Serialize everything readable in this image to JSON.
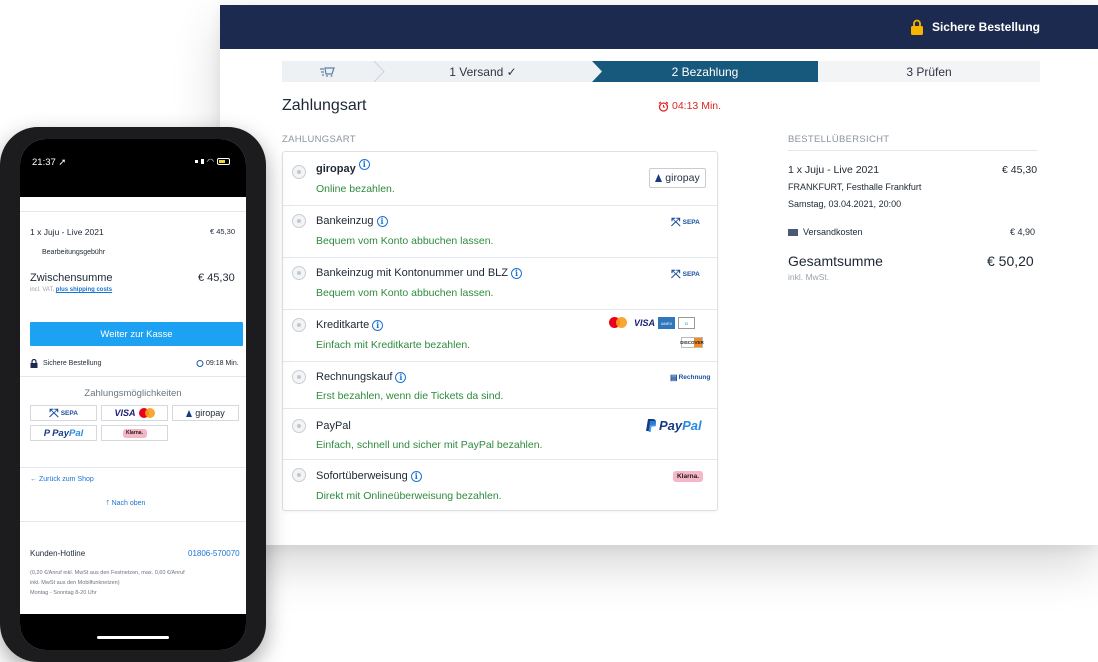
{
  "header": {
    "secure_label": "Sichere Bestellung"
  },
  "steps": [
    {
      "label": ""
    },
    {
      "label": "1 Versand ✓"
    },
    {
      "label": "2 Bezahlung"
    },
    {
      "label": "3 Prüfen"
    }
  ],
  "page_title": "Zahlungsart",
  "timer": "04:13 Min.",
  "section_label": "ZAHLUNGSART",
  "payment_methods": [
    {
      "name": "giropay",
      "desc": "Online bezahlen.",
      "logo": "giropay"
    },
    {
      "name": "Bankeinzug",
      "desc": "Bequem vom Konto abbuchen lassen.",
      "logo": "SEPA"
    },
    {
      "name": "Bankeinzug mit Kontonummer und BLZ",
      "desc": "Bequem vom Konto abbuchen lassen.",
      "logo": "SEPA"
    },
    {
      "name": "Kreditkarte",
      "desc": "Einfach mit Kreditkarte bezahlen.",
      "logo": "cards"
    },
    {
      "name": "Rechnungskauf",
      "desc": "Erst bezahlen, wenn die Tickets da sind.",
      "logo": "Rechnung"
    },
    {
      "name": "PayPal",
      "desc": "Einfach, schnell und sicher mit PayPal bezahlen.",
      "logo": "PayPal"
    },
    {
      "name": "Sofortüberweisung",
      "desc": "Direkt mit Onlineüberweisung bezahlen.",
      "logo": "Klarna."
    }
  ],
  "logos": {
    "giropay": "giropay",
    "sepa": "SEPA",
    "rechnung": "Rechnung",
    "paypal_1": "Pay",
    "paypal_2": "Pal",
    "klarna": "Klarna.",
    "visa": "VISA",
    "discover": "DISCOVER"
  },
  "overview": {
    "label": "BESTELLÜBERSICHT",
    "item": "1 x Juju - Live 2021",
    "item_price": "€ 45,30",
    "venue": "FRANKFURT, Festhalle Frankfurt",
    "date": "Samstag, 03.04.2021, 20:00",
    "shipping_label": "Versandkosten",
    "shipping_price": "€ 4,90",
    "total_label": "Gesamtsumme",
    "total_price": "€ 50,20",
    "tax_note": "inkl. MwSt."
  },
  "phone": {
    "time": "21:37",
    "item": "1 x Juju - Live 2021",
    "item_price": "€ 45,30",
    "fee": "Bearbeitungsgebühr",
    "subtotal_label": "Zwischensumme",
    "subtotal_price": "€ 45,30",
    "vat_note": "incl. VAT,",
    "shipping_link": "plus shipping costs",
    "cta": "Weiter zur Kasse",
    "secure": "Sichere Bestellung",
    "timer": "09:18 Min.",
    "payment_options": "Zahlungsmöglichkeiten",
    "back_link": "Zurück zum Shop",
    "top_link": "Nach oben",
    "hotline_label": "Kunden-Hotline",
    "hotline_number": "01806-570070",
    "hotline_note_1": "(0,20 €/Anruf inkl. MwSt aus den Festnetzen, max. 0,60 €/Anruf",
    "hotline_note_2": "inkl. MwSt aus den Mobilfunknetzen)",
    "hotline_hours": "Montag - Sonntag 8-20 Uhr"
  },
  "colors": {
    "navy": "#1b2a4e",
    "active_step": "#17587d",
    "green": "#2e8b3d",
    "cta_blue": "#1da1f2",
    "timer_red": "#e02424"
  }
}
